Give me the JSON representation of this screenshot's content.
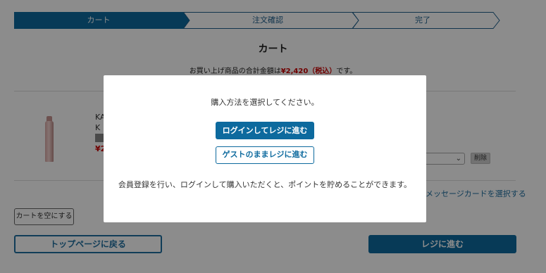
{
  "stepper": {
    "steps": [
      {
        "label": "カート",
        "state": "active"
      },
      {
        "label": "注文確認",
        "state": "inactive"
      },
      {
        "label": "完了",
        "state": "inactive"
      }
    ]
  },
  "page": {
    "title": "カート",
    "total_prefix": "お買い上げ商品の合計金額は",
    "total_amount": "¥2,420（税込）",
    "total_suffix": "です。"
  },
  "product": {
    "name_partial": "KA",
    "sub_partial": "K",
    "price_partial": "¥2"
  },
  "cart_item_controls": {
    "delete_label": "削除"
  },
  "message_card_link": "メッセージカードを選択する",
  "buttons": {
    "empty_cart": "カートを空にする",
    "back_to_top": "トップページに戻る",
    "checkout": "レジに進む"
  },
  "modal": {
    "prompt": "購入方法を選択してください。",
    "login_checkout": "ログインしてレジに進む",
    "guest_checkout": "ゲストのままレジに進む",
    "note": "会員登録を行い、ログインして購入いただくと、ポイントを貯めることができます。"
  },
  "colors": {
    "accent": "#0d6a9e",
    "price": "#cc0000",
    "overlay": "rgba(0,0,0,0.45)"
  }
}
